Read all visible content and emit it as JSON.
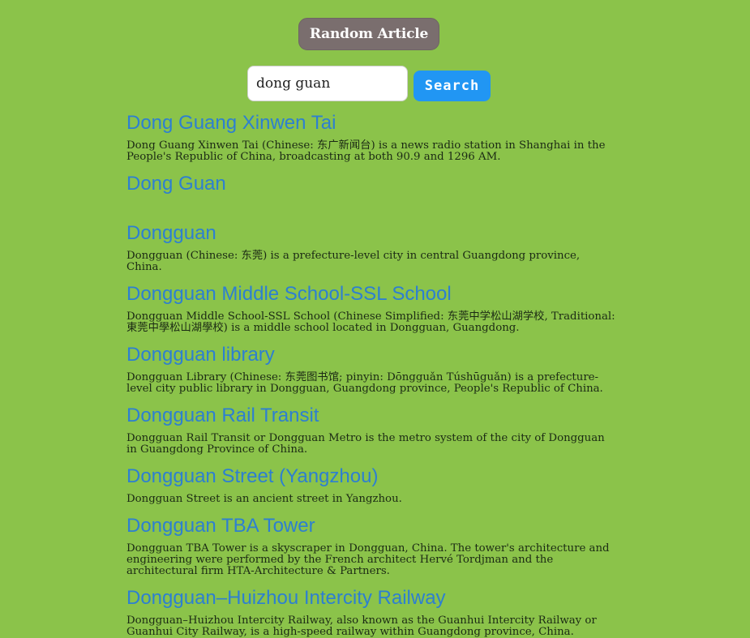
{
  "random_button": {
    "label": "Random Article"
  },
  "search": {
    "value": "dong guan",
    "placeholder": "",
    "button_label": "Search"
  },
  "results": [
    {
      "title": "Dong Guang Xinwen Tai",
      "snippet": "Dong Guang Xinwen Tai (Chinese: 东广新闻台) is a news radio station in Shanghai in the People's Republic of China, broadcasting at both 90.9 and 1296 AM."
    },
    {
      "title": "Dong Guan",
      "snippet": ""
    },
    {
      "title": "Dongguan",
      "snippet": "Dongguan (Chinese: 东莞) is a prefecture-level city in central Guangdong province, China."
    },
    {
      "title": "Dongguan Middle School-SSL School",
      "snippet": "Dongguan Middle School-SSL School (Chinese Simplified: 东莞中学松山湖学校, Traditional: 東莞中學松山湖學校) is a middle school located in Dongguan, Guangdong."
    },
    {
      "title": "Dongguan library",
      "snippet": "Dongguan Library (Chinese: 东莞图书馆; pinyin: Dōngguǎn Túshūguǎn) is a prefecture-level city public library in Dongguan, Guangdong province, People's Republic of China."
    },
    {
      "title": "Dongguan Rail Transit",
      "snippet": "Dongguan Rail Transit or Dongguan Metro is the metro system of the city of Dongguan in Guangdong Province of China."
    },
    {
      "title": "Dongguan Street (Yangzhou)",
      "snippet": "Dongguan Street is an ancient street in Yangzhou."
    },
    {
      "title": "Dongguan TBA Tower",
      "snippet": "Dongguan TBA Tower is a skyscraper in Dongguan, China. The tower's architecture and engineering were performed by the French architect Hervé Tordjman and the architectural firm HTA-Architecture & Partners."
    },
    {
      "title": "Dongguan–Huizhou Intercity Railway",
      "snippet": "Dongguan–Huizhou Intercity Railway, also known as the Guanhui Intercity Railway or Guanhui City Railway, is a high-speed railway within Guangdong province, China."
    }
  ],
  "colors": {
    "background": "#8bc34a",
    "link": "#2d7fd1",
    "search_button": "#2196f3",
    "random_button": "#7a6e6e"
  }
}
